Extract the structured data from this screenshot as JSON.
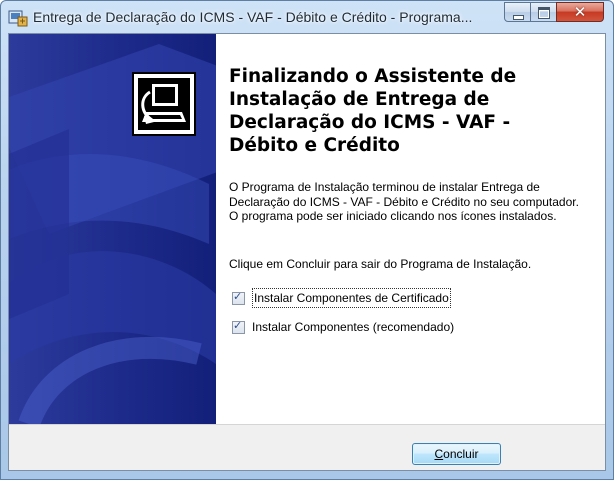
{
  "window": {
    "title": "Entrega de Declaração do ICMS - VAF - Débito e Crédito - Programa...",
    "controls": {
      "minimize_icon": "minimize-icon",
      "maximize_icon": "maximize-icon",
      "close_glyph": "✕"
    },
    "app_icon": "installer-app-icon"
  },
  "banner": {
    "logo_icon": "computer-disk-installer-icon"
  },
  "main": {
    "heading": "Finalizando o Assistente de Instalação de Entrega de Declaração do ICMS - VAF - Débito e Crédito",
    "paragraph1": "O Programa de Instalação terminou de instalar Entrega de Declaração do ICMS - VAF - Débito e Crédito no seu computador. O programa pode ser iniciado clicando nos ícones instalados.",
    "paragraph2": "Clique em Concluir para sair do Programa de Instalação.",
    "checkboxes": [
      {
        "label": "Instalar Componentes de Certificado",
        "checked": true,
        "focused": true
      },
      {
        "label": "Instalar Componentes (recomendado)",
        "checked": true,
        "focused": false
      }
    ]
  },
  "footer": {
    "finish_label_underlined": "C",
    "finish_label_rest": "oncluir"
  },
  "colors": {
    "banner": "#1d2a8a",
    "title_bar": "#b9d3ee",
    "close_button": "#c63a22",
    "button_border": "#3c7fb1"
  }
}
